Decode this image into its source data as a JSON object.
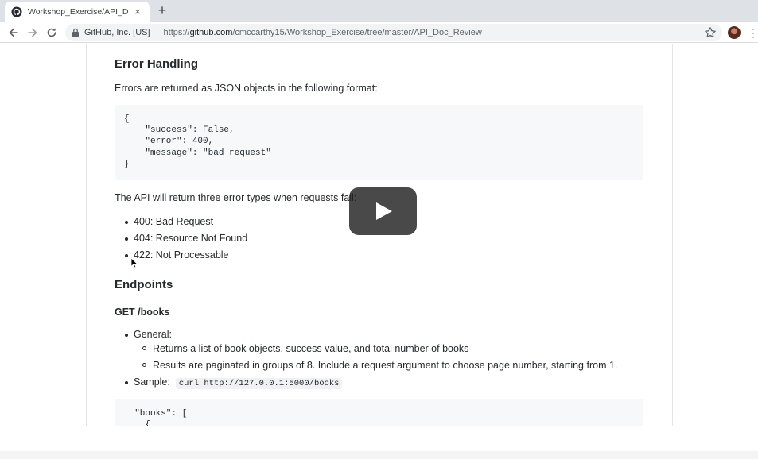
{
  "browser": {
    "tab_title": "Workshop_Exercise/API_Doc_Review",
    "tab_close": "×",
    "new_tab": "+",
    "cert_label": "GitHub, Inc. [US]",
    "url_scheme": "https://",
    "url_host": "github.com",
    "url_path": "/cmccarthy15/Workshop_Exercise/tree/master/API_Doc_Review",
    "menu": "⋮"
  },
  "doc": {
    "error_heading": "Error Handling",
    "error_intro": "Errors are returned as JSON objects in the following format:",
    "error_code": [
      "{",
      "    \"success\": False,",
      "    \"error\": 400,",
      "    \"message\": \"bad request\"",
      "}"
    ],
    "error_types_intro": "The API will return three error types when requests fail:",
    "error_types": [
      "400: Bad Request",
      "404: Resource Not Found",
      "422: Not Processable"
    ],
    "endpoints_heading": "Endpoints",
    "get_books_heading": "GET /books",
    "general_label": "General:",
    "general_items": [
      "Returns a list of book objects, success value, and total number of books",
      "Results are paginated in groups of 8. Include a request argument to choose page number, starting from 1."
    ],
    "sample_label": "Sample:",
    "sample_code": "curl http://127.0.0.1:5000/books",
    "books_code": [
      "  \"books\": [",
      "    {"
    ]
  },
  "icons": {
    "favicon": "github-icon",
    "back": "back-arrow-icon",
    "forward": "forward-arrow-icon",
    "reload": "reload-icon",
    "lock": "lock-icon",
    "star": "star-icon",
    "play": "play-icon",
    "cursor": "cursor-icon"
  }
}
